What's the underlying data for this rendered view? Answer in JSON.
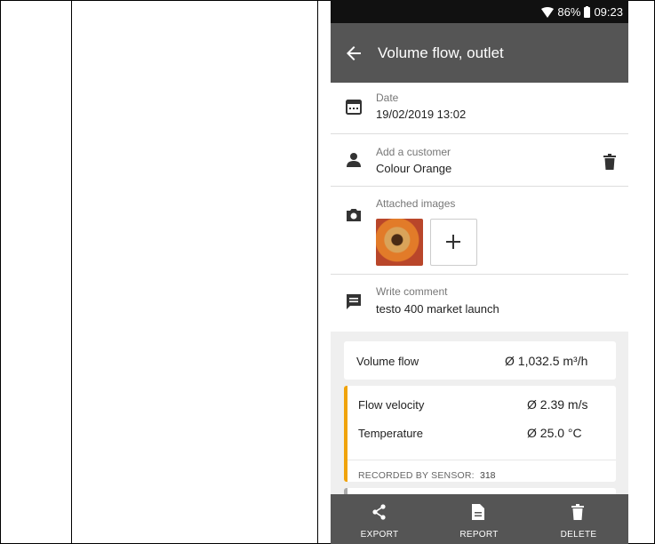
{
  "status_bar": {
    "battery": "86%",
    "time": "09:23"
  },
  "app_bar": {
    "title": "Volume flow, outlet"
  },
  "date_section": {
    "label": "Date",
    "value": "19/02/2019 13:02"
  },
  "customer_section": {
    "label": "Add a customer",
    "value": "Colour Orange"
  },
  "images_section": {
    "label": "Attached images"
  },
  "comment_section": {
    "label": "Write comment",
    "value": "testo 400 market launch"
  },
  "results": {
    "volume_flow": {
      "name": "Volume flow",
      "value": "Ø 1,032.5 m³/h"
    },
    "flow_velocity": {
      "name": "Flow velocity",
      "value": "Ø 2.39 m/s"
    },
    "temperature": {
      "name": "Temperature",
      "value": "Ø 25.0 °C"
    },
    "sensor": {
      "label": "RECORDED BY SENSOR:",
      "number": "318"
    }
  },
  "bottom_bar": {
    "export": "EXPORT",
    "report": "REPORT",
    "delete": "DELETE"
  },
  "colors": {
    "accent": "#f0a30a",
    "app_bar": "#555555",
    "status_bar": "#111111"
  }
}
